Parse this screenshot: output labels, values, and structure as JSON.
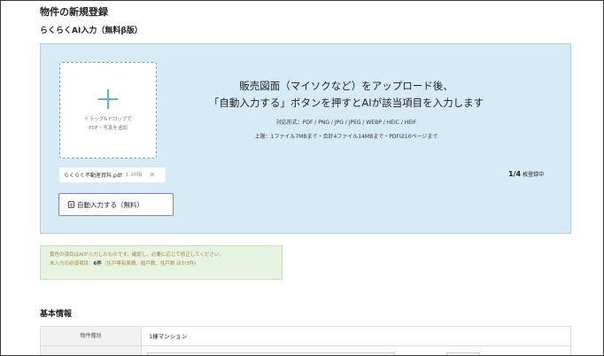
{
  "page": {
    "title": "物件の新規登録"
  },
  "ai_section": {
    "title": "らくらくAI入力（無料β版）",
    "dropzone": {
      "line1": "ドラッグ&ドロップで",
      "line2": "PDF・写真を追加"
    },
    "headline_line1": "販売図面（マイソクなど）をアップロード後、",
    "headline_line2": "「自動入力する」ボタンを押すとAIが該当項目を入力します",
    "spec_formats": "対応形式：PDF / PNG / JPG / JPEG / WEBP / HEIC / HEIF",
    "spec_limits": "上限：1ファイル7MBまで・合計4ファイル14MBまで・PDFは10ページまで",
    "file": {
      "name": "らくらく不動産資料.pdf",
      "size": "1.4MB"
    },
    "count": {
      "value": "1/4",
      "suffix": "枚登録中"
    },
    "auto_button_label": "自動入力する（無料）"
  },
  "notice": {
    "line1": "黄色の項目はAIが入力したものです。確認し、必要に応じて修正してください。",
    "line2_prefix": "未入力の必須項目：",
    "line2_count": "6件",
    "line2_detail": "（住戸専有面積、総戸数、住戸数 ほか3件）"
  },
  "basic_info": {
    "title": "基本情報",
    "rows": [
      {
        "label": "物件種別",
        "value": "1棟マンション"
      }
    ]
  },
  "colors": {
    "panel_bg": "#d7ebf7",
    "button_border": "#8c7ad0",
    "notice_bg": "#e8f4e2",
    "plus_icon": "#6fa9d4"
  }
}
